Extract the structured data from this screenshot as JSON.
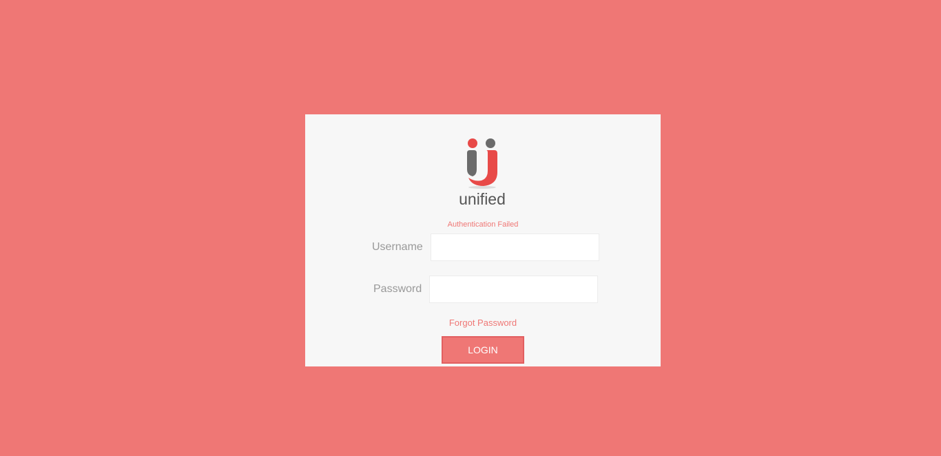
{
  "logo": {
    "text": "unified",
    "colors": {
      "accent": "#e84a48",
      "gray": "#6b6b6b"
    }
  },
  "message": {
    "error": "Authentication Failed"
  },
  "form": {
    "username_label": "Username",
    "username_value": "",
    "password_label": "Password",
    "password_value": "",
    "forgot_label": "Forgot Password",
    "login_label": "LOGIN"
  },
  "colors": {
    "page_background": "#ef7775",
    "card_background": "#f7f7f7",
    "accent": "#ef7775"
  }
}
